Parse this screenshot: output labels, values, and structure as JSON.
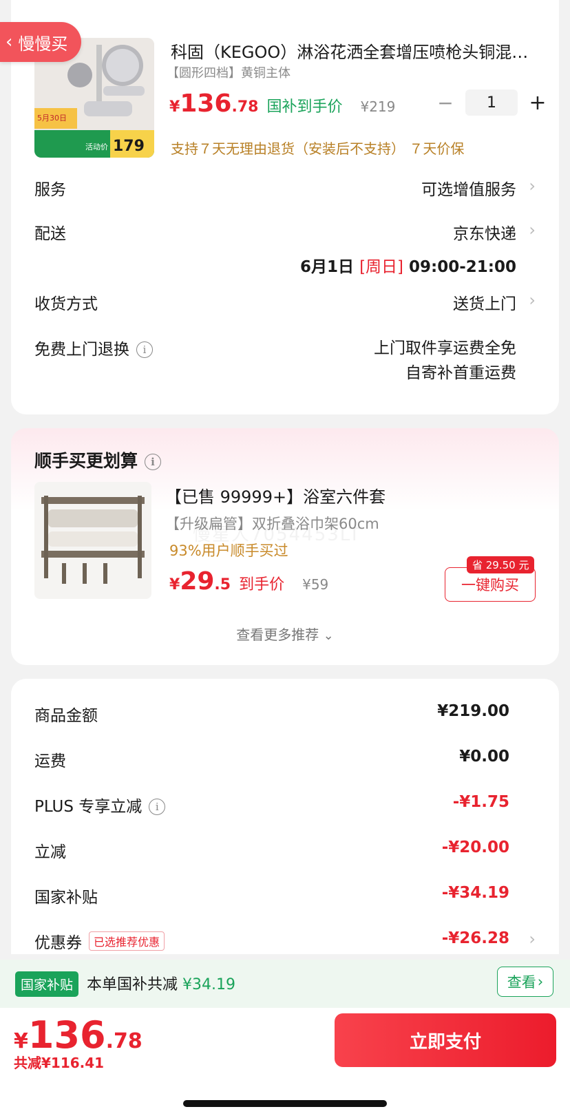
{
  "back_button": {
    "label": "慢慢买",
    "icon": "chevron-left-icon"
  },
  "product": {
    "title": "科固（KEGOO）淋浴花洒全套增压喷枪头铜混…",
    "spec": "【圆形四档】黄铜主体",
    "price_yen": "¥",
    "price_int": "136",
    "price_dec": ".78",
    "price_label": "国补到手价",
    "orig_price": "¥219",
    "quantity": "1",
    "minus": "−",
    "plus": "+",
    "return_note": "支持７天无理由退货（安装后不支持） ７天价保",
    "image_texts": {
      "date": "5月30日",
      "promo": "活动价",
      "price": "179"
    }
  },
  "rows": {
    "service": {
      "label": "服务",
      "value": "可选增值服务"
    },
    "delivery": {
      "label": "配送",
      "value": "京东快递",
      "date": "6月1日",
      "weekday": "[周日]",
      "time": "09:00-21:00"
    },
    "receive": {
      "label": "收货方式",
      "value": "送货上门"
    },
    "free_exchange": {
      "label": "免费上门退换",
      "value_line1": "上门取件享运费全免",
      "value_line2": "自寄补首重运费"
    }
  },
  "recommend": {
    "section_title": "顺手买更划算",
    "title": "【已售 99999+】浴室六件套",
    "spec": "【升级扁管】双折叠浴巾架60cm",
    "sold_note": "93%用户顺手买过",
    "price_yen": "¥",
    "price_int": "29",
    "price_dec": ".5",
    "price_label": "到手价",
    "orig_price": "¥59",
    "save_badge": "省 29.50 元",
    "buy_button": "一键购买",
    "more_link": "查看更多推荐",
    "watermark": "慢星人7054453LT"
  },
  "summary": [
    {
      "label": "商品金额",
      "value": "¥219.00",
      "red": false
    },
    {
      "label": "运费",
      "value": "¥0.00",
      "red": false
    },
    {
      "label": "PLUS 专享立减",
      "value": "-¥1.75",
      "red": true
    },
    {
      "label": "立减",
      "value": "-¥20.00",
      "red": true
    },
    {
      "label": "国家补贴",
      "value": "-¥34.19",
      "red": true
    },
    {
      "label": "优惠券",
      "value": "-¥26.28",
      "red": true,
      "tag": "已选推荐优惠"
    }
  ],
  "subsidy_strip": {
    "tag": "国家补贴",
    "text": "本单国补共减",
    "amount": "¥34.19",
    "button": "查看"
  },
  "footer": {
    "yen": "¥",
    "total_int": "136",
    "total_dec": ".78",
    "saved": "共减¥116.41",
    "pay_button": "立即支付"
  },
  "colors": {
    "accent_red": "#e8232f",
    "green": "#1aa35a",
    "gold": "#b88026"
  }
}
